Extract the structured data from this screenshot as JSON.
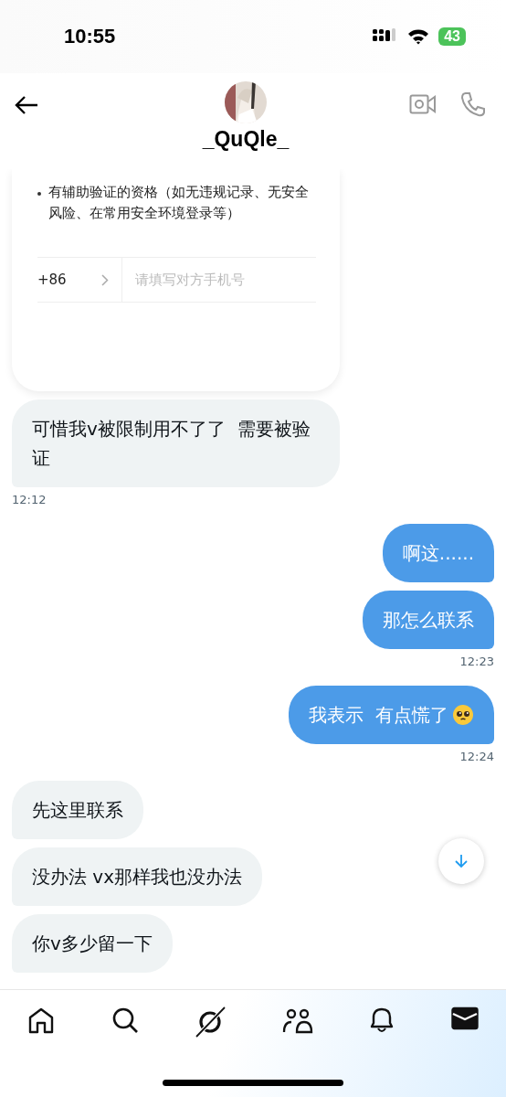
{
  "status_bar": {
    "time": "10:55",
    "battery": "43"
  },
  "header": {
    "username": "_QuQle_"
  },
  "card": {
    "bullet": "有辅助验证的资格（如无违规记录、无安全风险、在常用安全环境登录等）",
    "country_code": "+86",
    "phone_placeholder": "请填写对方手机号"
  },
  "messages": [
    {
      "kind": "received",
      "text": "可惜我v被限制用不了了  需要被验证",
      "time": "12:12"
    },
    {
      "kind": "sent",
      "text": "啊这......"
    },
    {
      "kind": "sent",
      "text": "那怎么联系",
      "time": "12:23"
    },
    {
      "kind": "sent",
      "text": "我表示  有点慌了",
      "emoji": true,
      "time": "12:24"
    },
    {
      "kind": "received",
      "text": "先这里联系"
    },
    {
      "kind": "received",
      "text": "没办法 vx那样我也没办法"
    },
    {
      "kind": "received",
      "text": "你v多少留一下"
    }
  ],
  "nav": [
    {
      "kind": "home",
      "selected": false
    },
    {
      "kind": "search",
      "selected": false
    },
    {
      "kind": "grok",
      "selected": false
    },
    {
      "kind": "communities",
      "selected": false
    },
    {
      "kind": "notifications",
      "selected": false
    },
    {
      "kind": "messages",
      "selected": true
    }
  ]
}
